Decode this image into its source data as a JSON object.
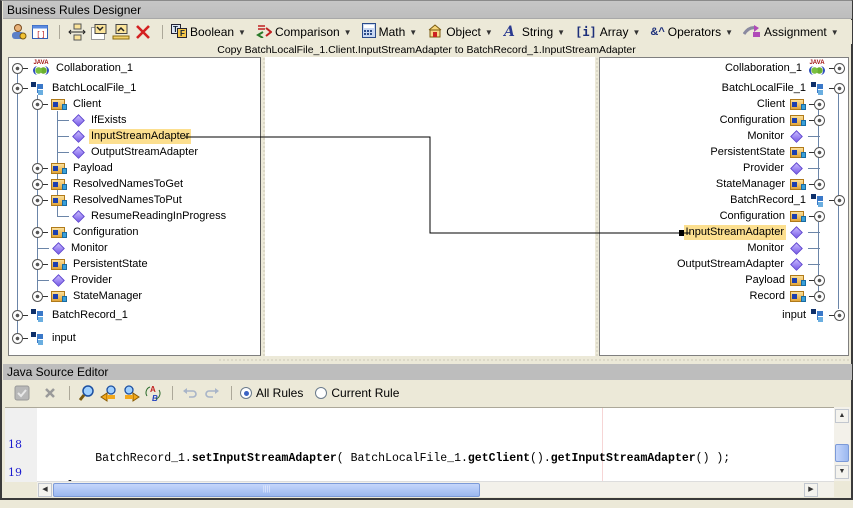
{
  "window": {
    "title": "Business Rules Designer"
  },
  "toolbar": {
    "icons": [
      "rule-properties-icon",
      "source-view-icon",
      "move-rule-icon",
      "move-down-icon",
      "move-up-icon",
      "delete-icon"
    ],
    "menus": [
      {
        "label": "Boolean",
        "icon": "boolean-icon"
      },
      {
        "label": "Comparison",
        "icon": "comparison-icon"
      },
      {
        "label": "Math",
        "icon": "math-icon"
      },
      {
        "label": "Object",
        "icon": "object-icon"
      },
      {
        "label": "String",
        "icon": "string-icon"
      },
      {
        "label": "Array",
        "icon": "array-icon"
      },
      {
        "label": "Operators",
        "icon": "operators-icon"
      },
      {
        "label": "Assignment",
        "icon": "assignment-icon"
      }
    ]
  },
  "status": {
    "text": "Copy BatchLocalFile_1.Client.InputStreamAdapter to BatchRecord_1.InputStreamAdapter"
  },
  "left_tree": {
    "nodes": [
      {
        "label": "Collaboration_1",
        "type": "java"
      },
      {
        "label": "BatchLocalFile_1",
        "type": "record"
      },
      {
        "label": "Client",
        "type": "folder"
      },
      {
        "label": "IfExists",
        "type": "field"
      },
      {
        "label": "InputStreamAdapter",
        "type": "field",
        "selected": true
      },
      {
        "label": "OutputStreamAdapter",
        "type": "field"
      },
      {
        "label": "Payload",
        "type": "folder"
      },
      {
        "label": "ResolvedNamesToGet",
        "type": "folder"
      },
      {
        "label": "ResolvedNamesToPut",
        "type": "folder"
      },
      {
        "label": "ResumeReadingInProgress",
        "type": "field"
      },
      {
        "label": "Configuration",
        "type": "folder"
      },
      {
        "label": "Monitor",
        "type": "field"
      },
      {
        "label": "PersistentState",
        "type": "folder"
      },
      {
        "label": "Provider",
        "type": "field"
      },
      {
        "label": "StateManager",
        "type": "folder"
      },
      {
        "label": "BatchRecord_1",
        "type": "record"
      },
      {
        "label": "input",
        "type": "record"
      }
    ]
  },
  "right_tree": {
    "nodes": [
      {
        "label": "Collaboration_1",
        "type": "java"
      },
      {
        "label": "BatchLocalFile_1",
        "type": "record"
      },
      {
        "label": "Client",
        "type": "folder"
      },
      {
        "label": "Configuration",
        "type": "folder"
      },
      {
        "label": "Monitor",
        "type": "field"
      },
      {
        "label": "PersistentState",
        "type": "folder"
      },
      {
        "label": "Provider",
        "type": "field"
      },
      {
        "label": "StateManager",
        "type": "folder"
      },
      {
        "label": "BatchRecord_1",
        "type": "record"
      },
      {
        "label": "Configuration",
        "type": "folder"
      },
      {
        "label": "InputStreamAdapter",
        "type": "field",
        "selected": true
      },
      {
        "label": "Monitor",
        "type": "field"
      },
      {
        "label": "OutputStreamAdapter",
        "type": "field"
      },
      {
        "label": "Payload",
        "type": "folder"
      },
      {
        "label": "Record",
        "type": "folder"
      },
      {
        "label": "input",
        "type": "record"
      }
    ]
  },
  "editor": {
    "title": "Java Source Editor",
    "radio_all": "All Rules",
    "radio_current": "Current Rule",
    "selected_scope": "All Rules",
    "lines": [
      {
        "number": "18",
        "pre": "        BatchRecord_1.",
        "b1": "setInputStreamAdapter",
        "mid": "( BatchLocalFile_1.",
        "b2": "getClient",
        "mid2": "().",
        "b3": "getInputStreamAdapter",
        "post": "() );"
      },
      {
        "number": "19",
        "pre": "    }",
        "b1": "",
        "mid": "",
        "b2": "",
        "mid2": "",
        "b3": "",
        "post": ""
      }
    ]
  }
}
